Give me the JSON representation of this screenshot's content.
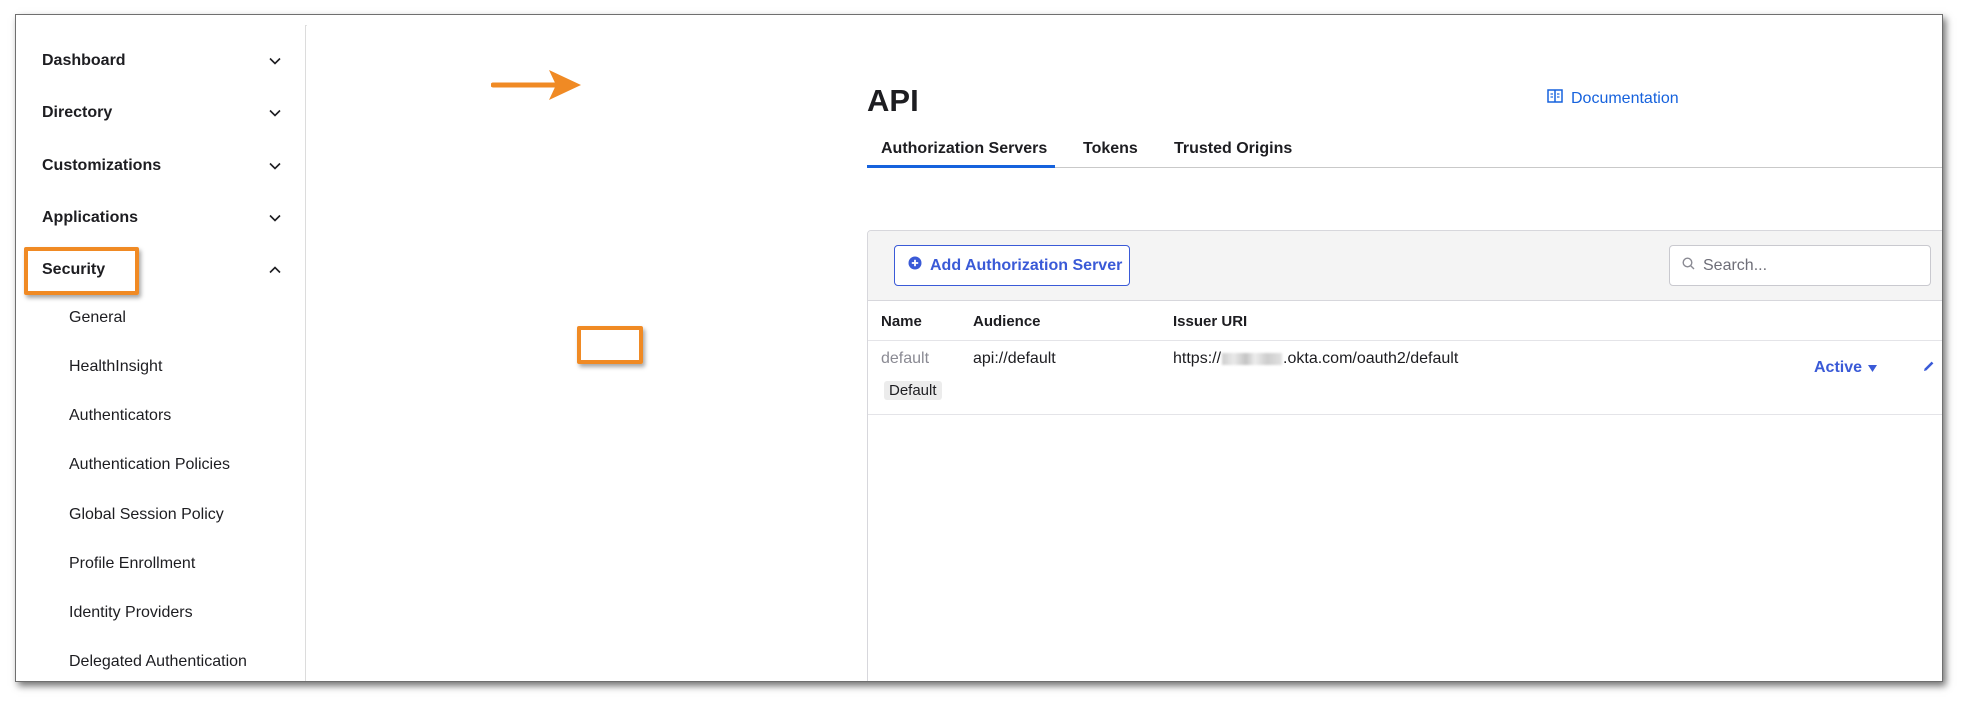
{
  "sidebar": {
    "groups": [
      {
        "label": "Dashboard",
        "expanded": false
      },
      {
        "label": "Directory",
        "expanded": false
      },
      {
        "label": "Customizations",
        "expanded": false
      },
      {
        "label": "Applications",
        "expanded": false
      },
      {
        "label": "Security",
        "expanded": true
      }
    ],
    "security_items": [
      "General",
      "HealthInsight",
      "Authenticators",
      "Authentication Policies",
      "Global Session Policy",
      "Profile Enrollment",
      "Identity Providers",
      "Delegated Authentication"
    ]
  },
  "header": {
    "title": "API",
    "documentation_label": "Documentation"
  },
  "tabs": [
    {
      "label": "Authorization Servers",
      "active": true
    },
    {
      "label": "Tokens",
      "active": false
    },
    {
      "label": "Trusted Origins",
      "active": false
    }
  ],
  "toolbar": {
    "add_label": "Add Authorization Server",
    "search_placeholder": "Search..."
  },
  "table": {
    "columns": [
      "Name",
      "Audience",
      "Issuer URI"
    ],
    "rows": [
      {
        "name": "default",
        "badge": "Default",
        "audience": "api://default",
        "issuer_prefix": "https://",
        "issuer_suffix": ".okta.com/oauth2/default",
        "status": "Active"
      }
    ]
  },
  "colors": {
    "accent": "#1662dd",
    "button": "#3a5ad7",
    "annotation": "#f08a24"
  },
  "icons": {
    "chevron_collapsed": "chevron-down-icon",
    "chevron_expanded": "chevron-up-icon",
    "documentation": "book-icon",
    "add": "plus-circle-icon",
    "search": "search-icon",
    "status_caret": "caret-down-icon",
    "edit": "pencil-icon"
  }
}
